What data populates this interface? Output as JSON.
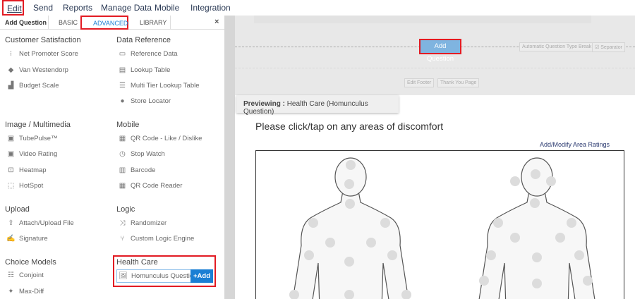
{
  "menu": {
    "items": [
      "Edit",
      "Send",
      "Reports",
      "Manage Data",
      "Mobile",
      "Integration"
    ]
  },
  "panel": {
    "title": "Add Question",
    "tabs": [
      "BASIC",
      "ADVANCED",
      "LIBRARY"
    ],
    "close": "×",
    "sections": {
      "customer_satisfaction": {
        "title": "Customer Satisfaction",
        "items": [
          "Net Promoter Score",
          "Van Westendorp",
          "Budget Scale"
        ]
      },
      "data_reference": {
        "title": "Data Reference",
        "items": [
          "Reference Data",
          "Lookup Table",
          "Multi Tier Lookup Table",
          "Store Locator"
        ]
      },
      "image_multimedia": {
        "title": "Image / Multimedia",
        "items": [
          "TubePulse™",
          "Video Rating",
          "Heatmap",
          "HotSpot"
        ]
      },
      "mobile": {
        "title": "Mobile",
        "items": [
          "QR Code - Like / Dislike",
          "Stop Watch",
          "Barcode",
          "QR Code Reader"
        ]
      },
      "upload": {
        "title": "Upload",
        "items": [
          "Attach/Upload File",
          "Signature"
        ]
      },
      "logic": {
        "title": "Logic",
        "items": [
          "Randomizer",
          "Custom Logic Engine"
        ]
      },
      "choice_models": {
        "title": "Choice Models",
        "items": [
          "Conjoint",
          "Max-Diff"
        ]
      },
      "health_care": {
        "title": "Health Care",
        "items": [
          "Homunculus Question"
        ],
        "add_label": "+Add"
      }
    }
  },
  "canvas": {
    "add_question": "Add Question",
    "auto_break": "Automatic Question Type Break",
    "separator": "☑ Separator",
    "edit_footer": "Edit Footer",
    "thank_you": "Thank You Page",
    "previewing_label": "Previewing :",
    "previewing_value": "Health Care (Homunculus Question)",
    "question": "Please click/tap on any areas of discomfort",
    "area_ratings": "Add/Modify Area Ratings"
  },
  "colors": {
    "accent": "#1a7fd4",
    "highlight": "#e21b23",
    "add_question_bg": "#7fb4e0"
  }
}
